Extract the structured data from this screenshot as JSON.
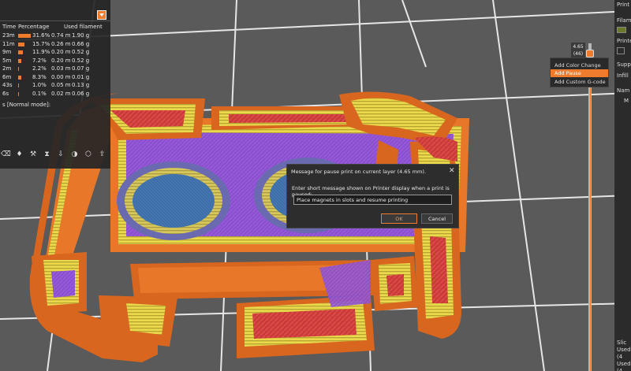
{
  "colors": {
    "accent": "#ee7c2c",
    "panel": "#262626",
    "bed": "#5a5a5a"
  },
  "legend": {
    "headers": [
      "Time",
      "Percentage",
      "Used filament"
    ],
    "rows": [
      {
        "time": "23m",
        "percent": "31.6%",
        "pct_value": 31.6,
        "length": "0.74 m",
        "weight": "1.90 g"
      },
      {
        "time": "11m",
        "percent": "15.7%",
        "pct_value": 15.7,
        "length": "0.26 m",
        "weight": "0.66 g"
      },
      {
        "time": "9m",
        "percent": "11.9%",
        "pct_value": 11.9,
        "length": "0.20 m",
        "weight": "0.52 g"
      },
      {
        "time": "5m",
        "percent": "7.2%",
        "pct_value": 7.2,
        "length": "0.20 m",
        "weight": "0.52 g"
      },
      {
        "time": "2m",
        "percent": "2.2%",
        "pct_value": 2.2,
        "length": "0.03 m",
        "weight": "0.07 g"
      },
      {
        "time": "6m",
        "percent": "8.3%",
        "pct_value": 8.3,
        "length": "0.00 m",
        "weight": "0.01 g"
      },
      {
        "time": "43s",
        "percent": "1.0%",
        "pct_value": 1.0,
        "length": "0.05 m",
        "weight": "0.13 g"
      },
      {
        "time": "6s",
        "percent": "0.1%",
        "pct_value": 0.1,
        "length": "0.02 m",
        "weight": "0.06 g"
      }
    ],
    "mode_text": "s [Normal mode]:"
  },
  "toolbar": {
    "icons": [
      "eraser-icon",
      "filament-icon",
      "tool-icon",
      "hourglass-icon",
      "extrude-icon",
      "checker-icon",
      "cube-icon",
      "export-icon"
    ]
  },
  "slider": {
    "value": "4.65",
    "layer": "(46)"
  },
  "context_menu": {
    "items": [
      "Add Color Change",
      "Add Pause",
      "Add Custom G-code"
    ],
    "selected_index": 1
  },
  "dialog": {
    "title": "Message for pause print on current layer (4.65 mm).",
    "prompt": "Enter short message shown on Printer display when a print is paused:",
    "input_value": "Place magnets in slots and resume printing",
    "ok_label": "OK",
    "cancel_label": "Cancel"
  },
  "right_panel": {
    "labels": [
      "Print s",
      "Filame",
      "Printe",
      "Suppo",
      "Infill",
      "Nam",
      "M",
      "Slic",
      "Used",
      "(4",
      "Used",
      "(4"
    ]
  }
}
